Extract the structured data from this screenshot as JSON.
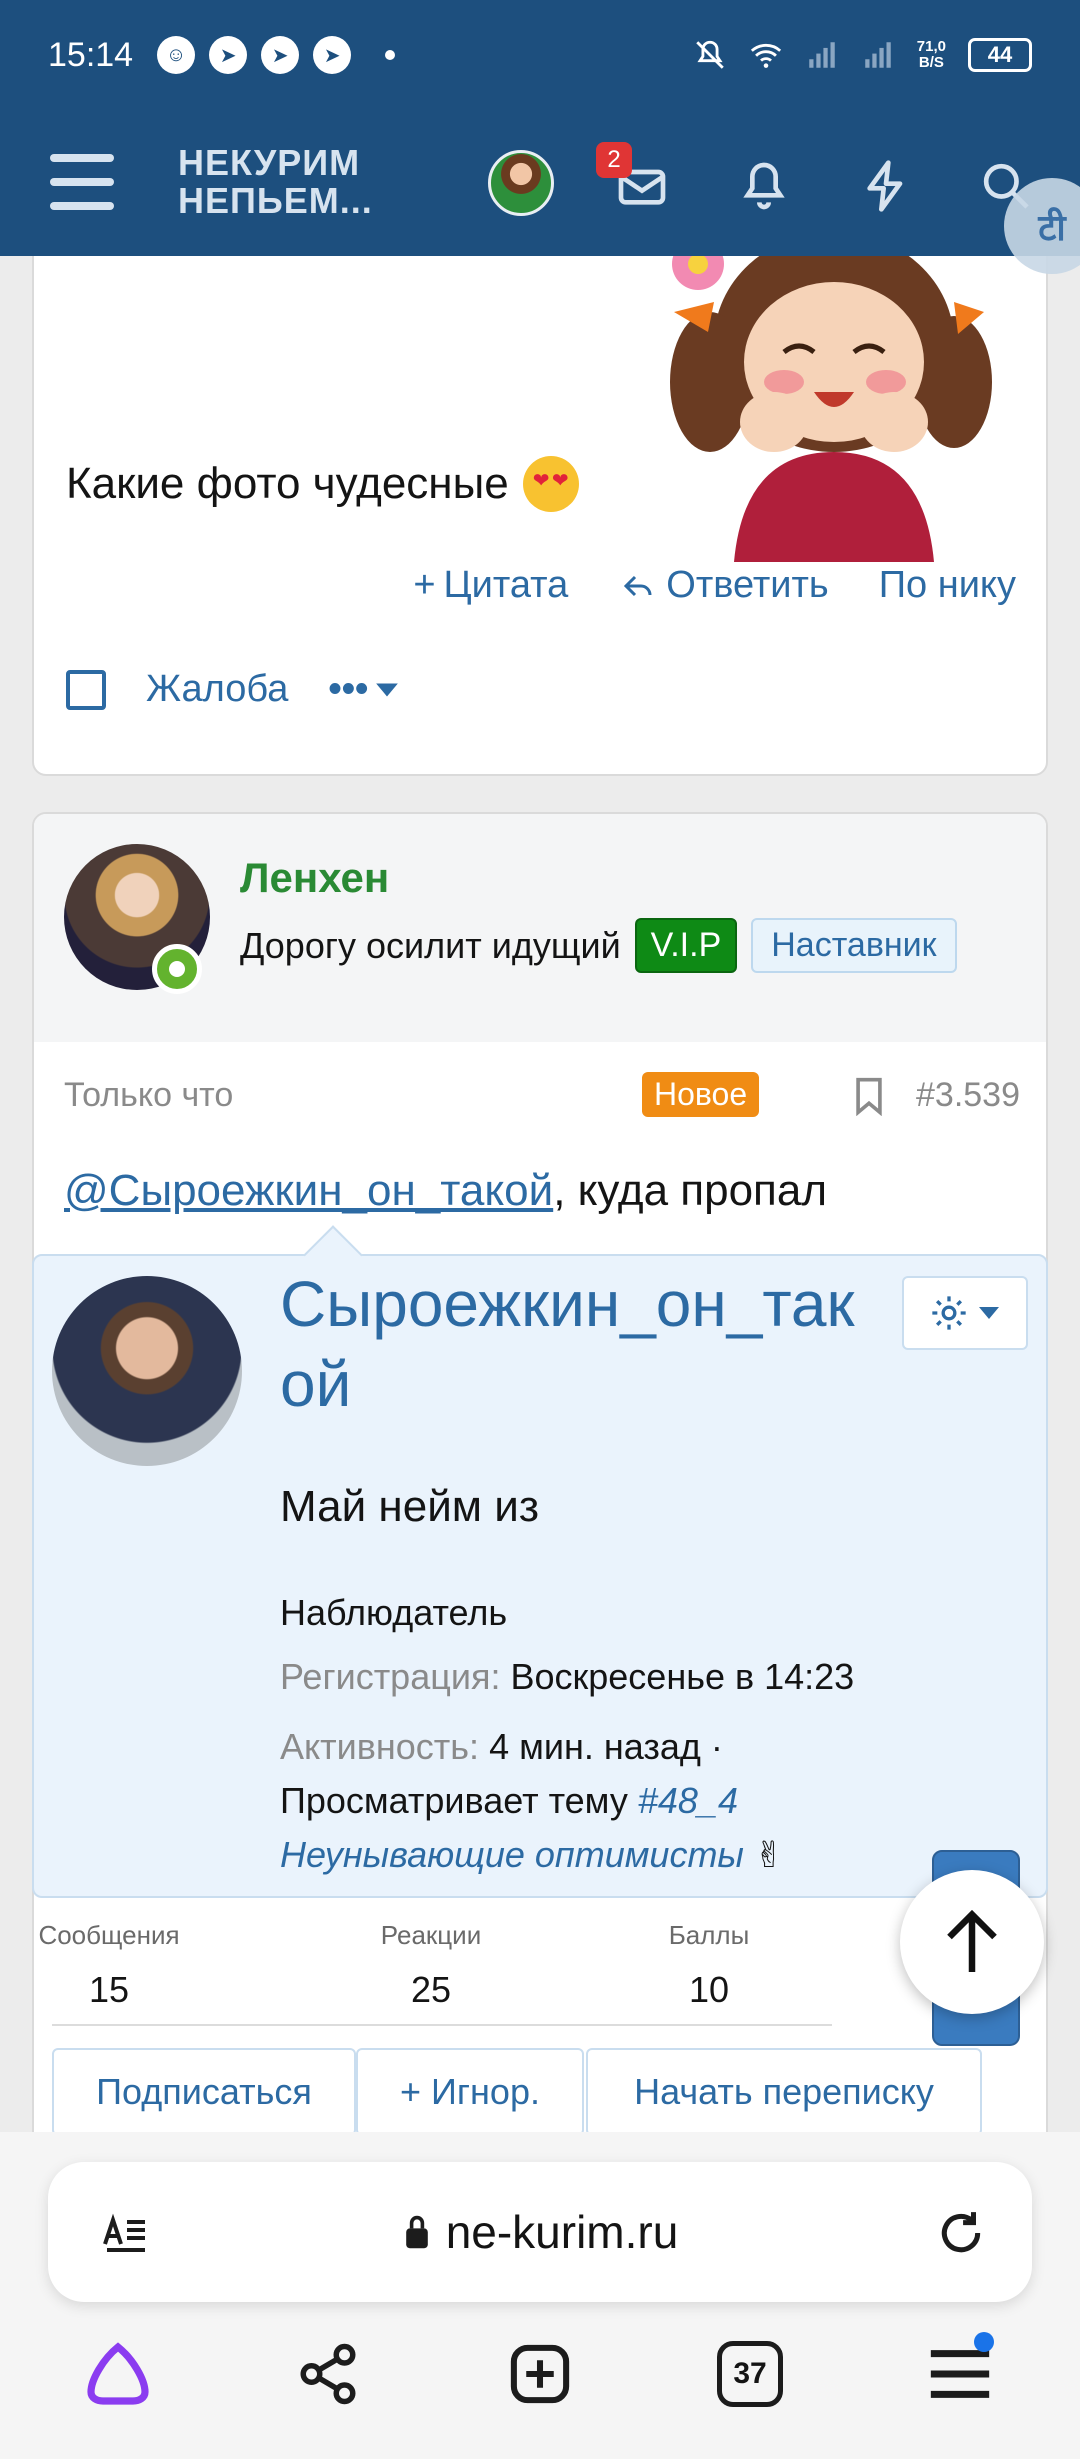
{
  "status_bar": {
    "time": "15:14",
    "app_icons": [
      "smiley-icon",
      "telegram-icon",
      "telegram-icon",
      "telegram-icon"
    ],
    "net_speed_value": "71,0",
    "net_speed_unit": "B/S",
    "battery": "44"
  },
  "header": {
    "logo_line1": "НЕКУРИМ",
    "logo_line2": "НЕПЬЕМ...",
    "messages_badge": "2",
    "translate_glyph": "टी"
  },
  "post1": {
    "text": "Какие фото чудесные",
    "actions": {
      "quote": "Цитата",
      "reply": "Ответить",
      "by_nick": "По нику"
    },
    "report": "Жалоба",
    "more": "•••"
  },
  "post2": {
    "author": {
      "name": "Ленхен",
      "title": "Дорогу осилит идущий",
      "vip_label": "V.I.P",
      "role_label": "Наставник"
    },
    "time": "Только что",
    "new_badge": "Новое",
    "post_number": "#3.539",
    "mention": "@Сыроежкин_он_такой",
    "text_rest": ", куда пропал"
  },
  "profile_tooltip": {
    "name": "Сыроежкин_он_такой",
    "status": "Май нейм из",
    "role": "Наблюдатель",
    "registration_label": "Регистрация:",
    "registration_value": "Воскресенье в 14:23",
    "activity_label": "Активность:",
    "activity_value": "4 мин. назад ·",
    "viewing_text": "Просматривает тему",
    "viewing_link": "#48_4",
    "thread_title": "Неунывающие оптимисты",
    "thread_emoji": "✌",
    "stats": [
      {
        "label": "Сообщения",
        "value": "15"
      },
      {
        "label": "Реакции",
        "value": "25"
      },
      {
        "label": "Баллы",
        "value": "10"
      }
    ],
    "buttons": {
      "follow": "Подписаться",
      "ignore": "+ Игнор.",
      "conversation": "Начать переписку"
    }
  },
  "browser": {
    "url": "ne-kurim.ru",
    "tabs_count": "37"
  },
  "colors": {
    "header_bg": "#1d4f7e",
    "link_blue": "#2c6aa3",
    "author_green": "#2a8a34",
    "vip_green": "#0e8a15",
    "new_orange": "#f08c14",
    "badge_red": "#e03535",
    "tooltip_bg": "#eaf3fc"
  }
}
